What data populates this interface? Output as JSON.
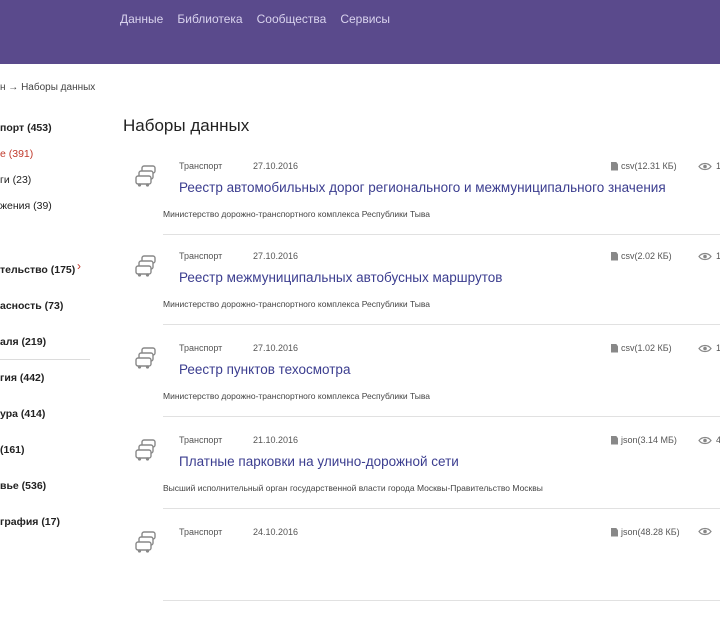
{
  "header": {
    "nav": [
      "Данные",
      "Библиотека",
      "Сообщества",
      "Сервисы"
    ]
  },
  "breadcrumb": "н → Наборы данных",
  "sidebar": {
    "items": [
      {
        "label": "порт (453)",
        "bold": true
      },
      {
        "label": "е (391)",
        "active": true
      },
      {
        "label": "ги (23)"
      },
      {
        "label": "жения (39)"
      },
      {
        "label": "тельство (175)",
        "bold": true
      },
      {
        "label": "асность (73)",
        "bold": true
      },
      {
        "label": "аля (219)",
        "bold": true
      },
      {
        "label": "гия (442)",
        "bold": true
      },
      {
        "label": "ура (414)",
        "bold": true
      },
      {
        "label": "(161)",
        "bold": true
      },
      {
        "label": "вье (536)",
        "bold": true
      },
      {
        "label": "графия (17)",
        "bold": true
      }
    ],
    "active_chevron": "›"
  },
  "main": {
    "title": "Наборы данных",
    "datasets": [
      {
        "category": "Транспорт",
        "date": "27.10.2016",
        "title": "Реестр автомобильных дорог регионального и межмуниципального значения",
        "org": "Министерство дорожно-транспортного комплекса Республики Тыва",
        "format": "csv(12.31 КБ)",
        "views": "1"
      },
      {
        "category": "Транспорт",
        "date": "27.10.2016",
        "title": "Реестр межмуниципальных автобусных маршрутов",
        "org": "Министерство дорожно-транспортного комплекса Республики Тыва",
        "format": "csv(2.02 КБ)",
        "views": "1"
      },
      {
        "category": "Транспорт",
        "date": "27.10.2016",
        "title": "Реестр пунктов техосмотра",
        "org": "Министерство дорожно-транспортного комплекса Республики Тыва",
        "format": "csv(1.02 КБ)",
        "views": "1"
      },
      {
        "category": "Транспорт",
        "date": "21.10.2016",
        "title": "Платные парковки на улично-дорожной сети",
        "org": "Высший исполнительный орган государственной власти города Москвы-Правительство Москвы",
        "format": "json(3.14 МБ)",
        "views": "4"
      },
      {
        "category": "Транспорт",
        "date": "24.10.2016",
        "title": "",
        "org": "",
        "format": "json(48.28 КБ)",
        "views": ""
      }
    ]
  },
  "colors": {
    "header_bg": "#5a4a8c",
    "link": "#3b3d8f",
    "active": "#c0392b"
  }
}
